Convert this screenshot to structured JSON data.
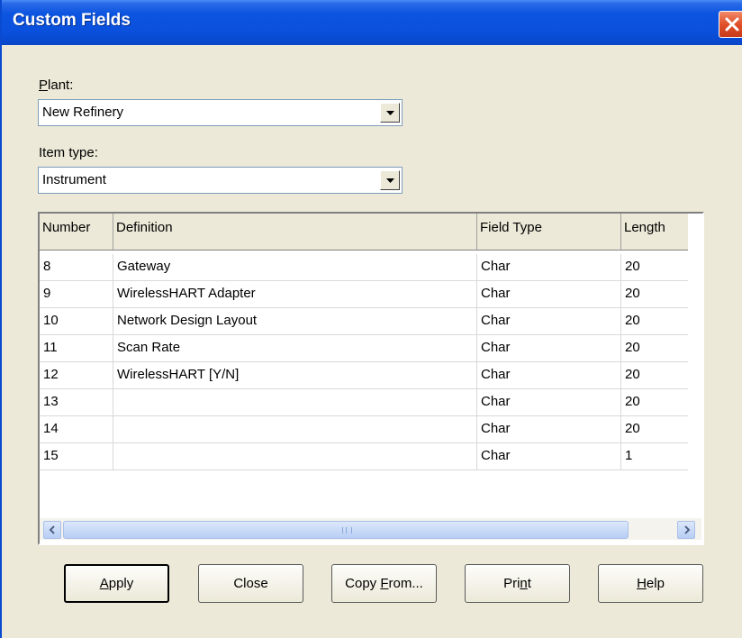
{
  "window": {
    "title": "Custom Fields"
  },
  "plant": {
    "label_prefix": "",
    "label_mnemonic": "P",
    "label_rest": "lant:",
    "value": "New Refinery"
  },
  "item_type": {
    "label": "Item type:",
    "value": "Instrument"
  },
  "table": {
    "columns": [
      "Number",
      "Definition",
      "Field Type",
      "Length"
    ],
    "rows": [
      [
        "8",
        "Gateway",
        "Char",
        "20"
      ],
      [
        "9",
        "WirelessHART Adapter",
        "Char",
        "20"
      ],
      [
        "10",
        "Network Design Layout",
        "Char",
        "20"
      ],
      [
        "11",
        "Scan Rate",
        "Char",
        "20"
      ],
      [
        "12",
        "WirelessHART [Y/N]",
        "Char",
        "20"
      ],
      [
        "13",
        "",
        "Char",
        "20"
      ],
      [
        "14",
        "",
        "Char",
        "20"
      ],
      [
        "15",
        "",
        "Char",
        "1"
      ]
    ]
  },
  "buttons": {
    "apply": {
      "mn": "A",
      "rest": "pply"
    },
    "close": {
      "label": "Close"
    },
    "copy_from": {
      "pre": "Copy ",
      "mn": "F",
      "rest": "rom..."
    },
    "print": {
      "pre": "Pri",
      "mn": "n",
      "rest": "t"
    },
    "help": {
      "mn": "H",
      "rest": "elp"
    }
  },
  "icons": {
    "close": "close-x-icon",
    "dropdown": "chevron-down-icon",
    "scroll_up": "arrow-up-icon",
    "scroll_down": "arrow-down-icon",
    "scroll_left": "arrow-left-icon",
    "scroll_right": "arrow-right-icon"
  },
  "colors": {
    "titlebar": "#0a50dc",
    "dialog_bg": "#ece9d8",
    "close_button": "#e0502a"
  }
}
